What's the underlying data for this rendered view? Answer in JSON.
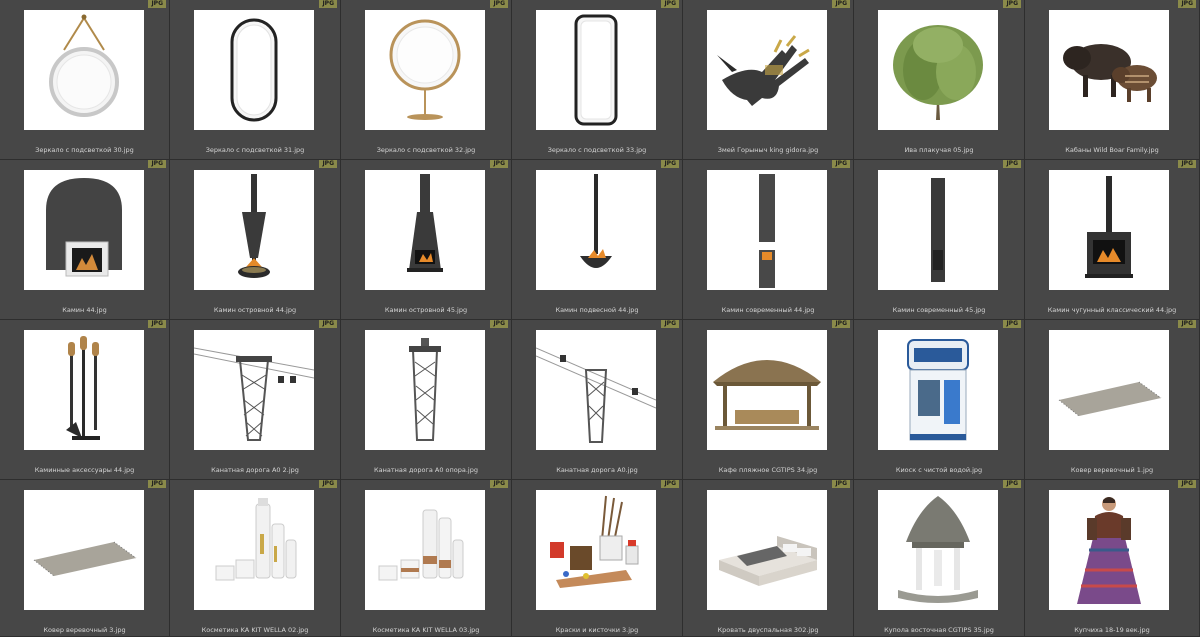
{
  "badge_label": "JPG",
  "items": [
    {
      "label": "Зеркало с подсветкой 30.jpg",
      "icon": "round-mirror-on-strap-icon"
    },
    {
      "label": "Зеркало с подсветкой 31.jpg",
      "icon": "oval-mirror-icon"
    },
    {
      "label": "Зеркало с подсветкой 32.jpg",
      "icon": "round-standing-mirror-icon"
    },
    {
      "label": "Зеркало с подсветкой 33.jpg",
      "icon": "rectangular-mirror-icon"
    },
    {
      "label": "Змей Горыныч king gidora.jpg",
      "icon": "three-headed-dragon-icon"
    },
    {
      "label": "Ива плакучая 05.jpg",
      "icon": "willow-tree-icon"
    },
    {
      "label": "Кабаны Wild Boar Family.jpg",
      "icon": "wild-boars-icon"
    },
    {
      "label": "Камин 44.jpg",
      "icon": "arched-fireplace-icon"
    },
    {
      "label": "Камин островной 44.jpg",
      "icon": "cone-hood-fireplace-icon"
    },
    {
      "label": "Камин островной 45.jpg",
      "icon": "tall-island-fireplace-icon"
    },
    {
      "label": "Камин подвесной 44.jpg",
      "icon": "hanging-fireplace-icon"
    },
    {
      "label": "Камин современный 44.jpg",
      "icon": "modern-cylinder-fireplace-icon"
    },
    {
      "label": "Камин современный 45.jpg",
      "icon": "column-fireplace-icon"
    },
    {
      "label": "Камин чугунный классический 44.jpg",
      "icon": "cast-iron-stove-icon"
    },
    {
      "label": "Каминные аксессуары 44.jpg",
      "icon": "fireplace-tools-icon"
    },
    {
      "label": "Канатная дорога А0 2.jpg",
      "icon": "cable-car-tower-icon"
    },
    {
      "label": "Канатная дорога А0 опора.jpg",
      "icon": "lattice-tower-icon"
    },
    {
      "label": "Канатная дорога А0.jpg",
      "icon": "cable-car-line-icon"
    },
    {
      "label": "Кафе пляжное CGTIPS 34.jpg",
      "icon": "beach-cafe-hut-icon"
    },
    {
      "label": "Киоск с чистой водой.jpg",
      "icon": "water-kiosk-icon"
    },
    {
      "label": "Ковер веревочный 1.jpg",
      "icon": "rope-rug-icon"
    },
    {
      "label": "Ковер веревочный 3.jpg",
      "icon": "rope-rug-icon"
    },
    {
      "label": "Косметика KA KIT WELLA 02.jpg",
      "icon": "cosmetics-bottles-icon"
    },
    {
      "label": "Косметика KA KIT WELLA 03.jpg",
      "icon": "cosmetics-jars-icon"
    },
    {
      "label": "Краски и кисточки 3.jpg",
      "icon": "paints-and-brushes-icon"
    },
    {
      "label": "Кровать двуспальная 302.jpg",
      "icon": "double-bed-icon"
    },
    {
      "label": "Купола восточная CGTIPS 35.jpg",
      "icon": "thatched-gazebo-icon"
    },
    {
      "label": "Купчиха 18-19 век.jpg",
      "icon": "merchant-woman-figure-icon"
    }
  ]
}
